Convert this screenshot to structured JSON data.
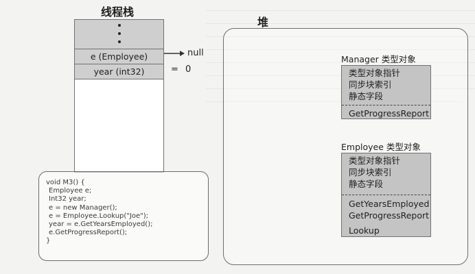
{
  "stack_title": "线程栈",
  "heap_title": "堆",
  "stack": {
    "e_slot": "e (Employee)",
    "e_value": "null",
    "year_slot": "year (int32)",
    "year_value": "0"
  },
  "manager_object": {
    "title": "Manager 类型对象",
    "header_fields": [
      "类型对象指针",
      "同步块索引",
      "静态字段"
    ],
    "methods": [
      "GetProgressReport"
    ]
  },
  "employee_object": {
    "title": "Employee 类型对象",
    "header_fields": [
      "类型对象指针",
      "同步块索引",
      "静态字段"
    ],
    "methods": [
      "GetYearsEmployed",
      "GetProgressReport",
      "Lookup"
    ]
  },
  "code_lines": [
    "void M3() {",
    "Employee e;",
    "Int32 year;",
    "e = new Manager();",
    "e = Employee.Lookup(\"Joe\");",
    "year = e.GetYearsEmployed();",
    "e.GetProgressReport();",
    "}"
  ],
  "colors": {
    "cell": "#cfcfcf",
    "object": "#c4c4c4",
    "border": "#707070"
  }
}
